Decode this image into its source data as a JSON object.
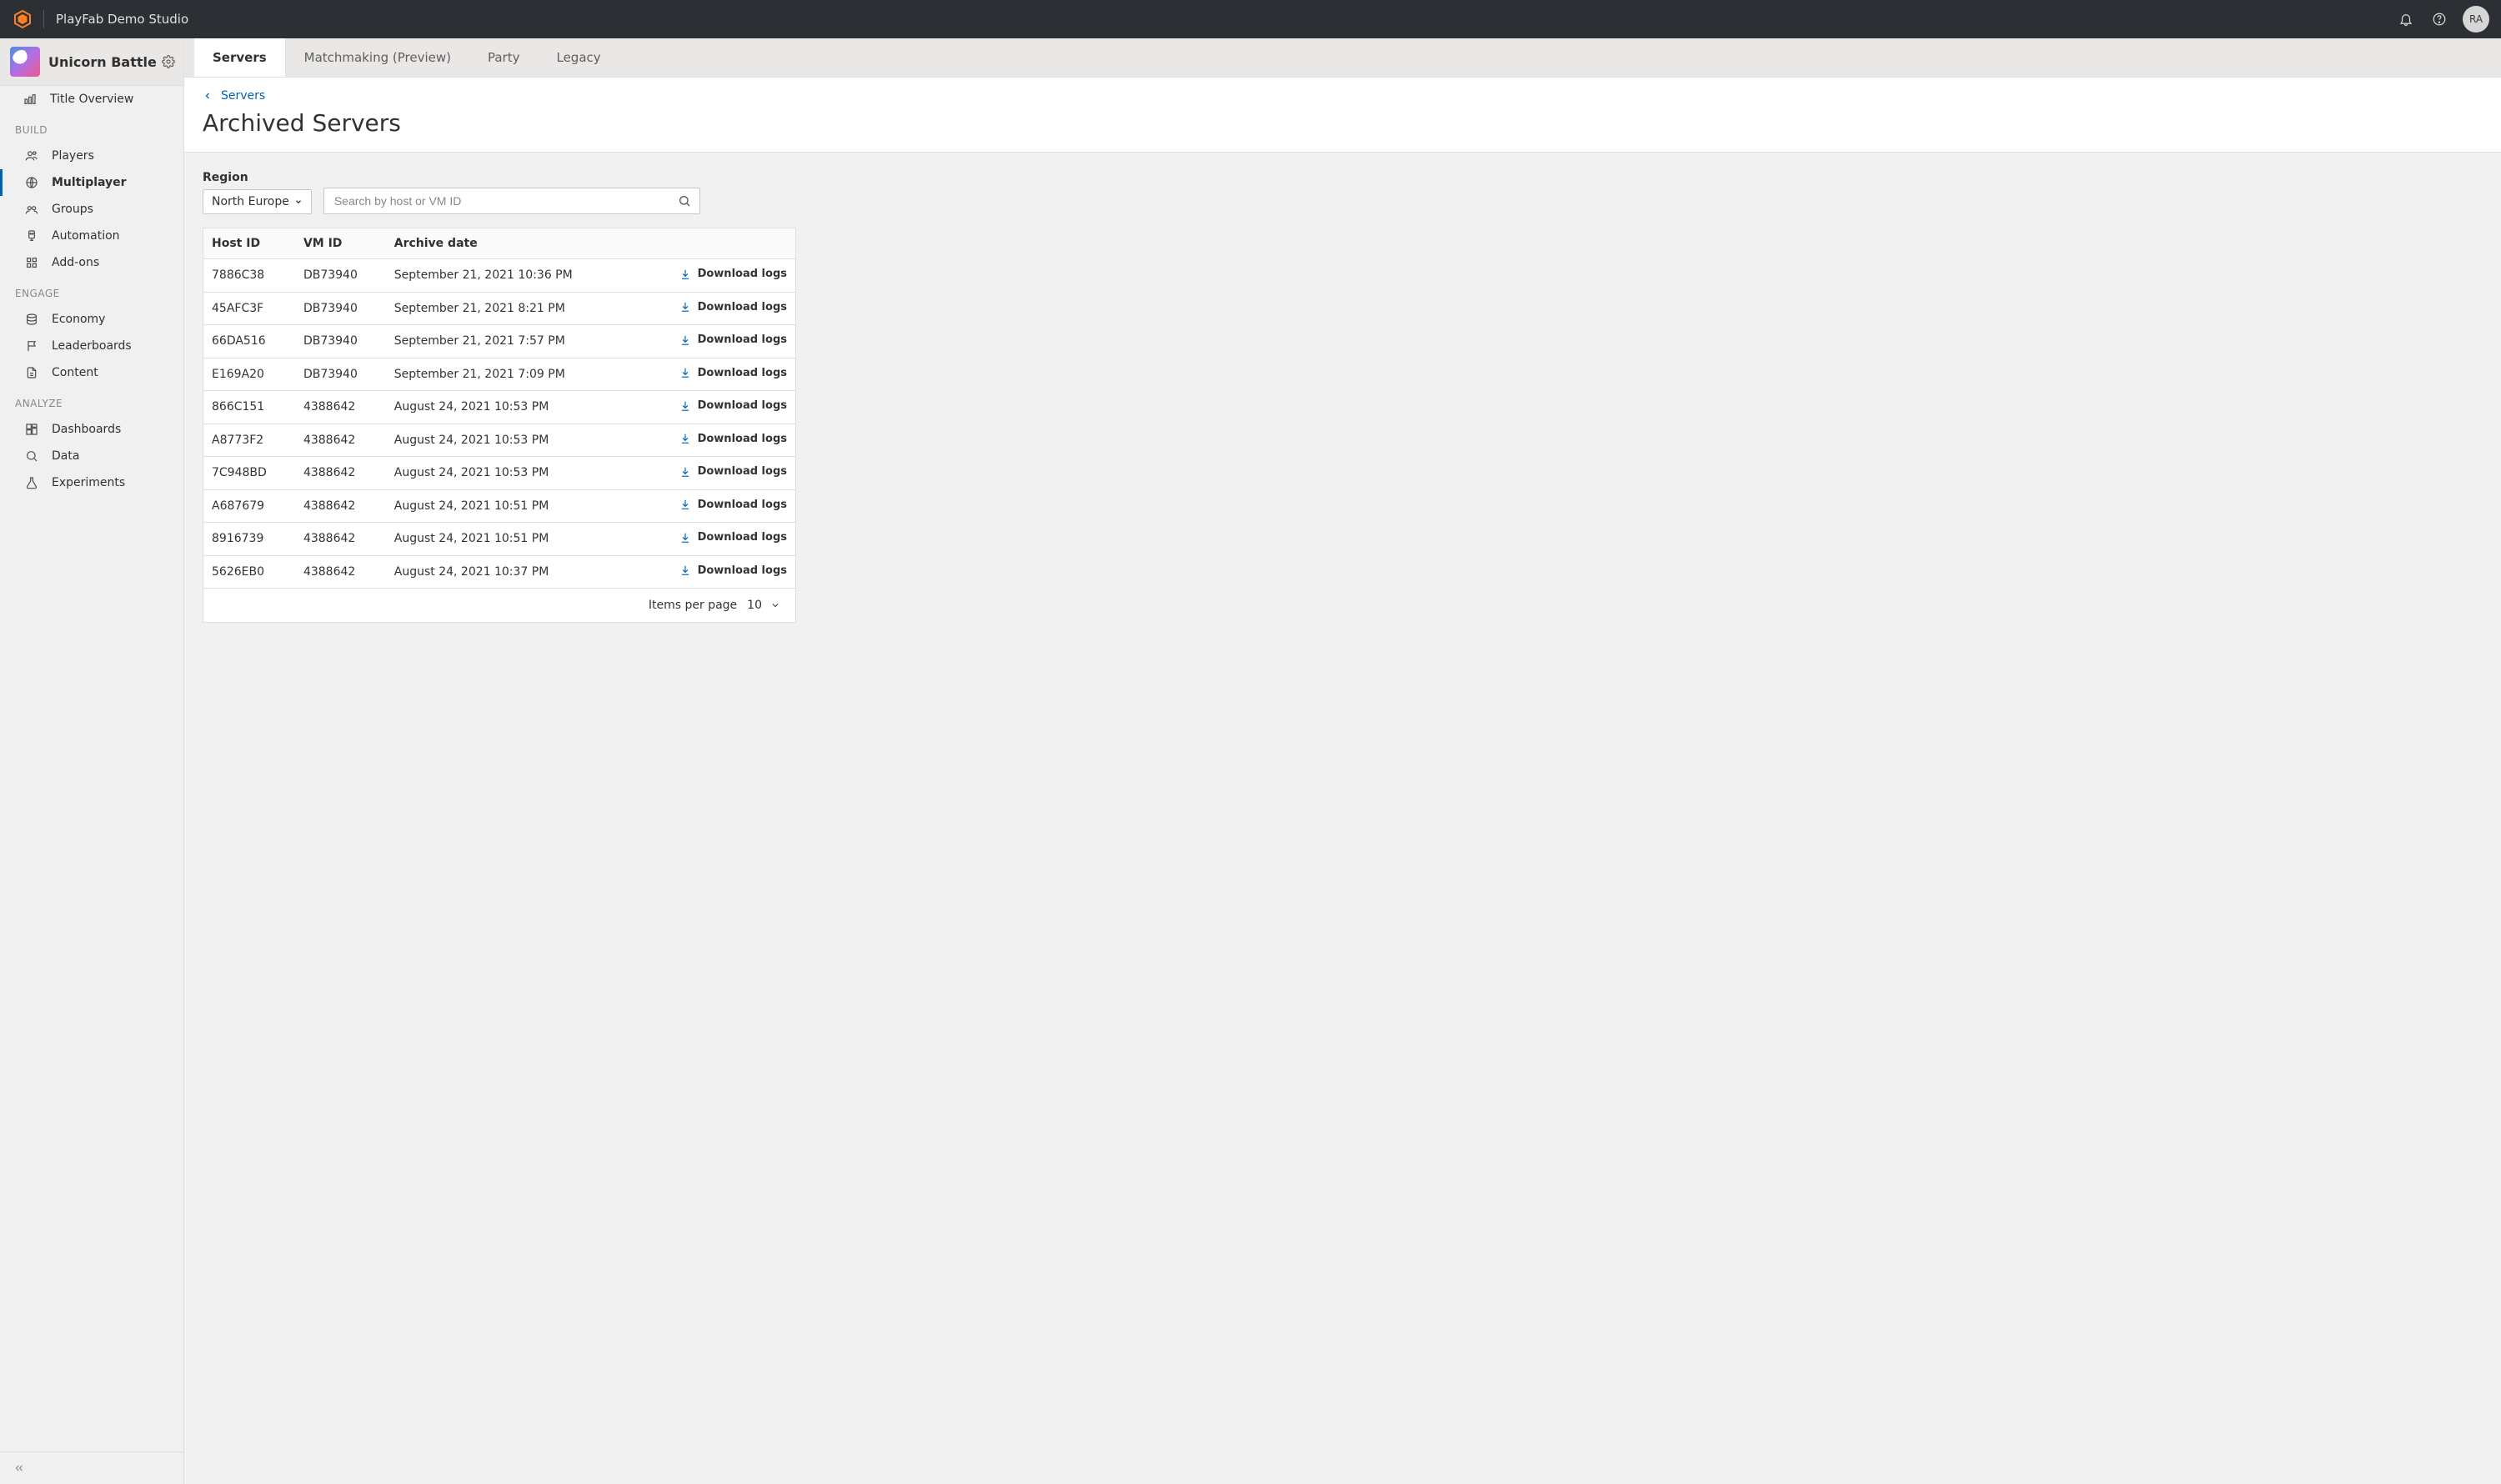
{
  "header": {
    "studio": "PlayFab Demo Studio",
    "avatar": "RA"
  },
  "sidebar": {
    "game_title": "Unicorn Battle",
    "overview": "Title Overview",
    "groups": [
      {
        "label": "BUILD",
        "items": [
          "Players",
          "Multiplayer",
          "Groups",
          "Automation",
          "Add-ons"
        ]
      },
      {
        "label": "ENGAGE",
        "items": [
          "Economy",
          "Leaderboards",
          "Content"
        ]
      },
      {
        "label": "ANALYZE",
        "items": [
          "Dashboards",
          "Data",
          "Experiments"
        ]
      }
    ],
    "active": "Multiplayer"
  },
  "tabs": {
    "items": [
      "Servers",
      "Matchmaking (Preview)",
      "Party",
      "Legacy"
    ],
    "active": 0
  },
  "page": {
    "breadcrumb": "Servers",
    "title": "Archived Servers",
    "region_label": "Region",
    "region_value": "North Europe",
    "search_placeholder": "Search by host or VM ID"
  },
  "table": {
    "columns": [
      "Host ID",
      "VM ID",
      "Archive date"
    ],
    "download_label": "Download logs",
    "rows": [
      {
        "host": "7886C38",
        "vm": "DB73940",
        "date": "September 21, 2021 10:36 PM"
      },
      {
        "host": "45AFC3F",
        "vm": "DB73940",
        "date": "September 21, 2021 8:21 PM"
      },
      {
        "host": "66DA516",
        "vm": "DB73940",
        "date": "September 21, 2021 7:57 PM"
      },
      {
        "host": "E169A20",
        "vm": "DB73940",
        "date": "September 21, 2021 7:09 PM"
      },
      {
        "host": "866C151",
        "vm": "4388642",
        "date": "August 24, 2021 10:53 PM"
      },
      {
        "host": "A8773F2",
        "vm": "4388642",
        "date": "August 24, 2021 10:53 PM"
      },
      {
        "host": "7C948BD",
        "vm": "4388642",
        "date": "August 24, 2021 10:53 PM"
      },
      {
        "host": "A687679",
        "vm": "4388642",
        "date": "August 24, 2021 10:51 PM"
      },
      {
        "host": "8916739",
        "vm": "4388642",
        "date": "August 24, 2021 10:51 PM"
      },
      {
        "host": "5626EB0",
        "vm": "4388642",
        "date": "August 24, 2021 10:37 PM"
      }
    ],
    "footer": {
      "label": "Items per page",
      "value": "10"
    }
  }
}
